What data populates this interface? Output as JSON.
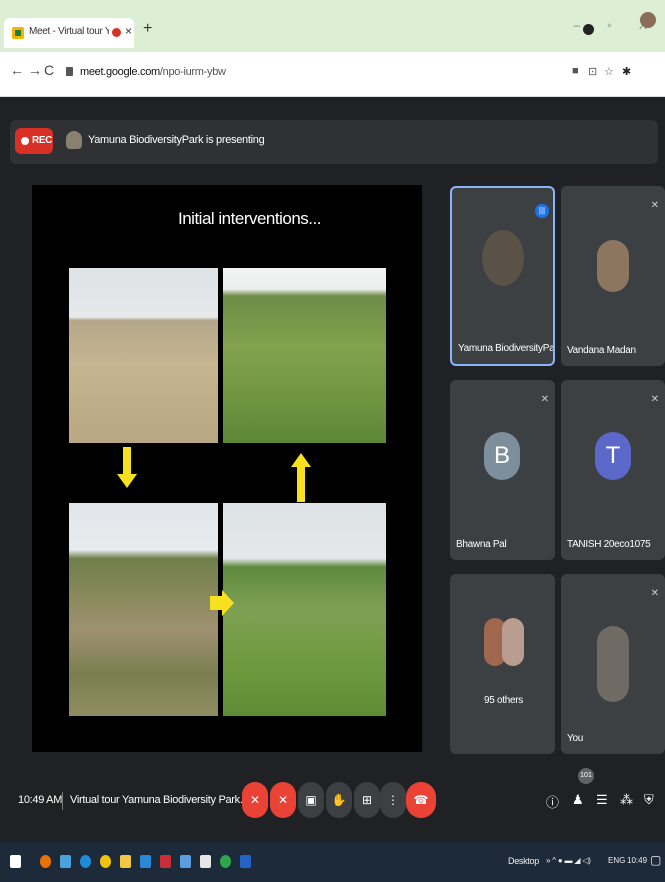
{
  "browser": {
    "tab_title": "Meet - Virtual tour Yamuna I",
    "tab_close": "×",
    "new_tab": "+",
    "url_host": "meet.google.com",
    "url_path": "/npo-iurm-ybw",
    "window_controls": "‒ ▫ X",
    "back": "←",
    "forward": "→",
    "reload": "C"
  },
  "meet": {
    "rec_label": "REC",
    "presenting_text": "Yamuna BiodiversityPark is presenting",
    "slide_title": "Initial interventions...",
    "tiles": [
      {
        "name": "Yamuna BiodiversityPark"
      },
      {
        "name": "Vandana Madan"
      },
      {
        "name": "Bhawna Pal",
        "initial": "B"
      },
      {
        "name": "TANISH 20eco1075",
        "initial": "T"
      },
      {
        "name": "95 others"
      },
      {
        "name": "You"
      }
    ],
    "time": "10:49 AM",
    "meeting_title": "Virtual tour Yamuna Biodiversity Park...",
    "participant_count": "101",
    "colors": {
      "red": "#ea4335",
      "tile_bg": "#3c4043",
      "slide_arrow": "#f7e11f",
      "bp_avatar": "#7d8f9c",
      "t_avatar": "#5b67c9"
    }
  },
  "taskbar": {
    "desktop_label": "Desktop",
    "lang": "ENG",
    "clock": "10:49"
  }
}
